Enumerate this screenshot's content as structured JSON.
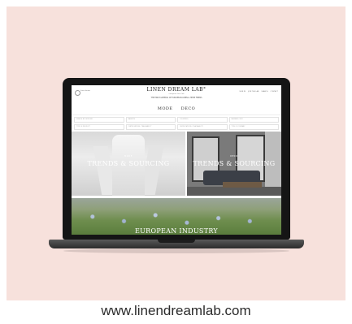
{
  "site": {
    "logo_text": "linen dream",
    "brand": "LINEN DREAM LAB°",
    "brand_sub": "european linen lab",
    "tagline": "THE ENCYCLOPEDIA OF EUROPEAN LINEN & HEMP FIBERS",
    "top_links": [
      "SIGN IN",
      "JOIN THE LAB",
      "SEARCH",
      "CONTACT"
    ]
  },
  "nav": {
    "items": [
      "MODE",
      "DECO"
    ]
  },
  "filters": [
    "SEARCH BY KEYWORD",
    "MARKETS",
    "COUNTRIES",
    "MEMBERS ONLY",
    "TYPE OF PRODUCT",
    "CERTIFICATIONS / TRACEABILITY",
    "CERTIFICATIONS / TRACEABILITY",
    "TYPE OF COMPANY"
  ],
  "tiles": {
    "fashion": {
      "kicker": "MODE",
      "title": "TRENDS & SOURCING"
    },
    "deco": {
      "kicker": "DECO",
      "title": "TRENDS & SOURCING"
    },
    "industry": {
      "title": "EUROPEAN INDUSTRY"
    }
  },
  "caption": "www.linendreamlab.com",
  "colors": {
    "background": "#f7e1dc",
    "laptop": "#151515",
    "caption_text": "#2b2b2b"
  }
}
